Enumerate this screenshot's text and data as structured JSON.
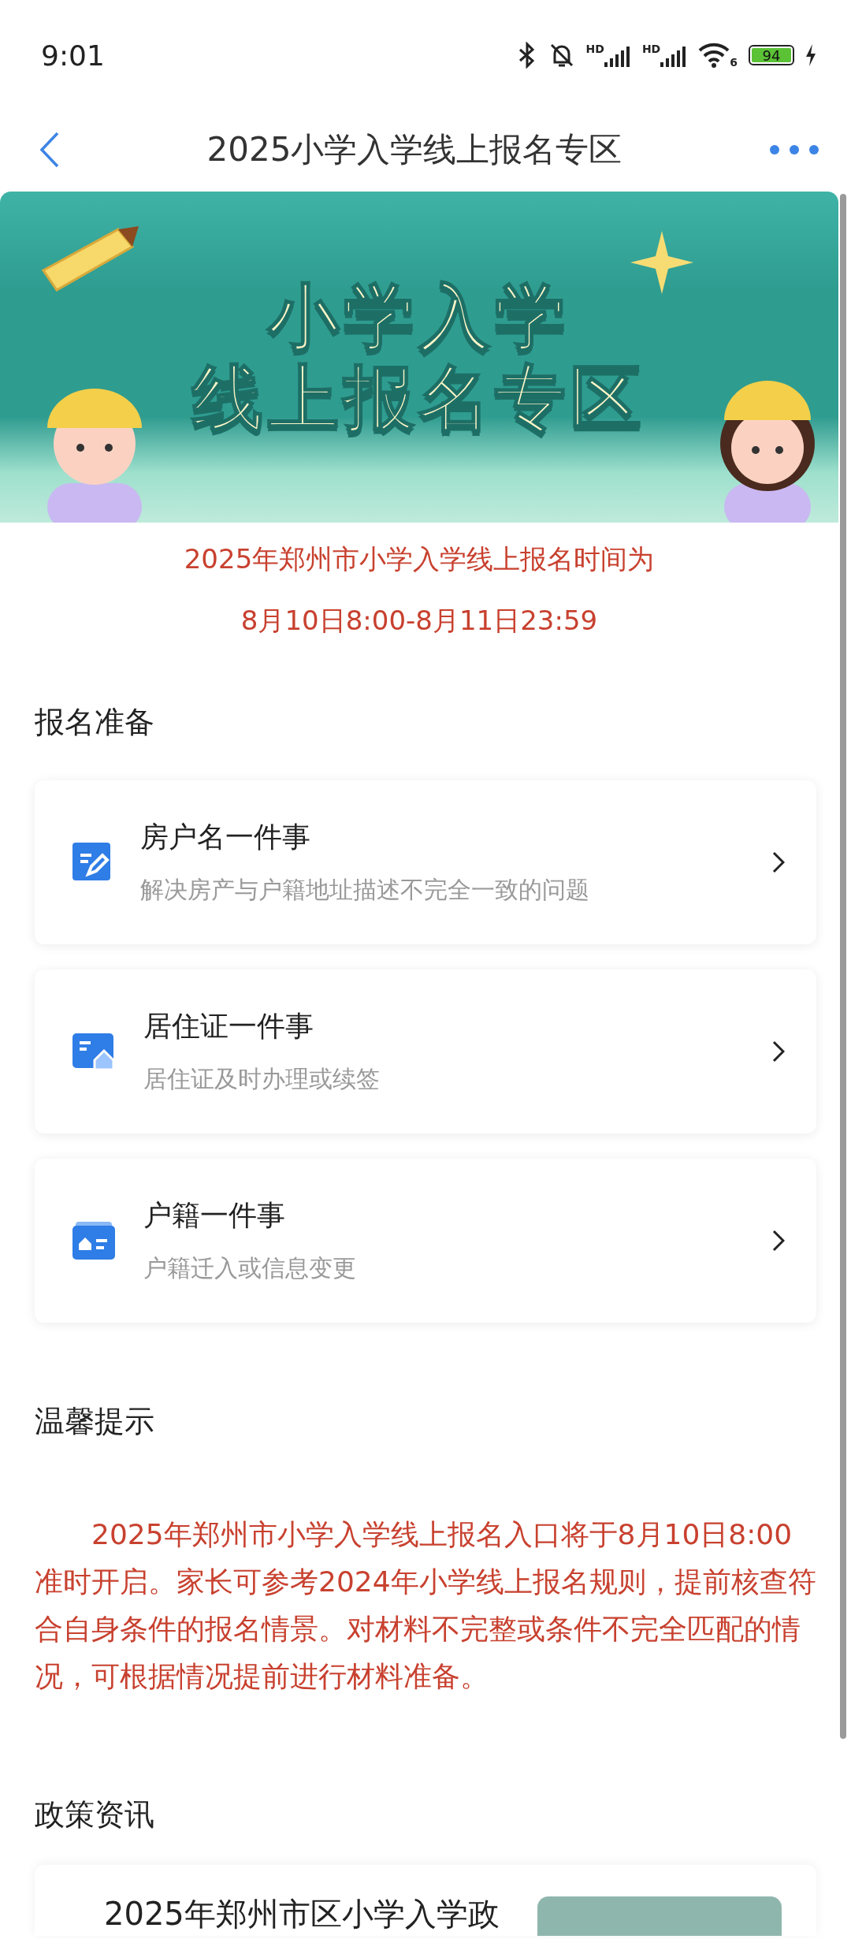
{
  "status_bar": {
    "time": "9:01",
    "signals": [
      {
        "label": "HD"
      },
      {
        "label": "HD"
      }
    ],
    "wifi_label": "6",
    "battery": "94"
  },
  "nav": {
    "title": "2025小学入学线上报名专区"
  },
  "banner": {
    "lines": [
      "小学入学",
      "线上报名专区"
    ]
  },
  "notice": [
    "2025年郑州市小学入学线上报名时间为",
    "8月10日8:00-8月11日23:59"
  ],
  "prep": {
    "heading": "报名准备",
    "items": [
      {
        "kind": "house",
        "title": "房户名一件事",
        "subtitle": "解决房产与户籍地址描述不完全一致的问题"
      },
      {
        "kind": "residence",
        "title": "居住证一件事",
        "subtitle": "居住证及时办理或续签"
      },
      {
        "kind": "hukou",
        "title": "户籍一件事",
        "subtitle": "户籍迁入或信息变更"
      }
    ]
  },
  "tips": {
    "heading": "温馨提示",
    "text": "2025年郑州市小学入学线上报名入口将于8月10日8:00准时开启。家长可参考2024年小学线上报名规则，提前核查符合自身条件的报名情景。对材料不完整或条件不完全匹配的情况，可根据情况提前进行材料准备。"
  },
  "news": {
    "heading": "政策资讯",
    "items": [
      {
        "title": "2025年郑州市区小学入学政"
      }
    ]
  }
}
